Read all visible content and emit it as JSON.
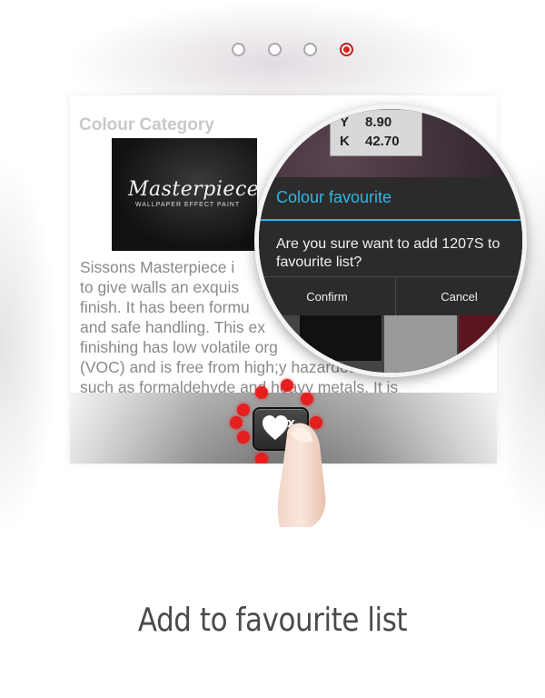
{
  "pager": {
    "count": 4,
    "active_index": 3
  },
  "card": {
    "title": "Colour Category",
    "product_image": {
      "brand": "Masterpiece",
      "tagline": "WALLPAPER EFFECT PAINT"
    },
    "description": "Sissons Masterpiece i... to give walls an exquisi... finish. It has been formul... and safe handling. This ex... finishing has low volatile orga... (VOC) and is free from high;y hazardous matters such as formaldehyde and heavy metals. It is",
    "desc_lines": [
      "Sissons Masterpiece i",
      "to give walls an exquis",
      "finish. It has been formu",
      "and safe handling. This ex",
      "finishing has low volatile org",
      "(VOC) and is free from high;y hazardous matters",
      "such as formaldehyde and heavy metals. It is"
    ]
  },
  "cmyk": [
    {
      "label": "Y",
      "value": "8.90"
    },
    {
      "label": "K",
      "value": "42.70"
    }
  ],
  "dialog": {
    "title": "Colour favourite",
    "message_line1": "Are you sure want to add 1207S to",
    "message_line2": "favourite list?",
    "confirm_label": "Confirm",
    "cancel_label": "Cancel"
  },
  "caption": "Add to favourite list",
  "colors": {
    "accent_blue": "#33b5e5",
    "dialog_bg": "#2b2b2b",
    "tap_red": "#e61e1e",
    "active_dot": "#e02020"
  }
}
